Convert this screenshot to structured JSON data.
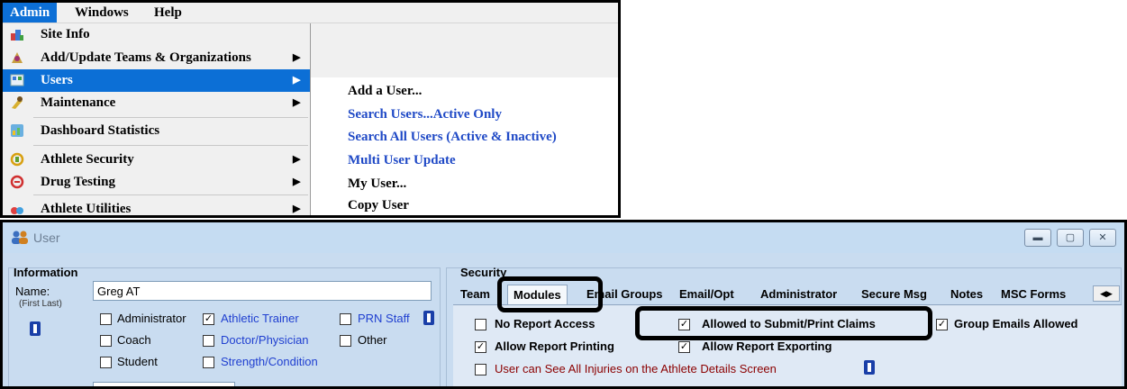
{
  "menubar": {
    "items": [
      "Admin",
      "Windows",
      "Help"
    ]
  },
  "admin_menu": {
    "items": [
      {
        "label": "Site Info",
        "icon": "site-info-icon",
        "submenu": false
      },
      {
        "label": "Add/Update Teams & Organizations",
        "icon": "teams-icon",
        "submenu": true
      },
      {
        "label": "Users",
        "icon": "users-icon",
        "submenu": true,
        "selected": true
      },
      {
        "label": "Maintenance",
        "icon": "maintenance-icon",
        "submenu": true
      },
      {
        "label": "Dashboard Statistics",
        "icon": "dashboard-icon",
        "submenu": false
      },
      {
        "label": "Athlete Security",
        "icon": "security-icon",
        "submenu": true
      },
      {
        "label": "Drug Testing",
        "icon": "drug-testing-icon",
        "submenu": true
      },
      {
        "label": "Athlete Utilities",
        "icon": "utilities-icon",
        "submenu": true
      }
    ]
  },
  "users_submenu": {
    "items": [
      {
        "label": "Add a User...",
        "color": "black"
      },
      {
        "label": "Search Users...Active Only",
        "color": "blue"
      },
      {
        "label": "Search All Users (Active & Inactive)",
        "color": "blue"
      },
      {
        "label": "Multi User Update",
        "color": "blue"
      },
      {
        "label": "My User...",
        "color": "black"
      },
      {
        "label": "Copy User",
        "color": "black"
      }
    ]
  },
  "window": {
    "title": "User",
    "buttons": [
      "minimize",
      "restore",
      "close"
    ]
  },
  "information": {
    "title": "Information",
    "name_label": "Name:",
    "name_hint": "(First Last)",
    "name_value": "Greg AT",
    "roles": [
      {
        "label": "Administrator",
        "checked": false,
        "color": "black"
      },
      {
        "label": "Athletic Trainer",
        "checked": true,
        "color": "blue"
      },
      {
        "label": "PRN Staff",
        "checked": false,
        "color": "blue"
      },
      {
        "label": "Coach",
        "checked": false,
        "color": "black"
      },
      {
        "label": "Doctor/Physician",
        "checked": false,
        "color": "blue"
      },
      {
        "label": "Other",
        "checked": false,
        "color": "black"
      },
      {
        "label": "Student",
        "checked": false,
        "color": "black"
      },
      {
        "label": "Strength/Condition",
        "checked": false,
        "color": "blue"
      }
    ]
  },
  "security": {
    "title": "Security",
    "tabs": [
      "Team",
      "Modules",
      "Email Groups",
      "Email/Opt",
      "Administrator",
      "Secure Msg",
      "Notes",
      "MSC Forms"
    ],
    "active_tab": "Modules",
    "options": [
      {
        "label": "No Report Access",
        "checked": false
      },
      {
        "label": "Allowed to Submit/Print Claims",
        "checked": true
      },
      {
        "label": "Group Emails Allowed",
        "checked": true
      },
      {
        "label": "Allow Report Printing",
        "checked": true
      },
      {
        "label": "Allow Report Exporting",
        "checked": true
      },
      {
        "label": "User can See All Injuries on the Athlete Details Screen",
        "checked": false,
        "color": "red"
      }
    ]
  },
  "colors": {
    "menu_highlight": "#0c6fd6",
    "link_blue": "#1f49c6",
    "window_bg": "#c9dcf0"
  }
}
